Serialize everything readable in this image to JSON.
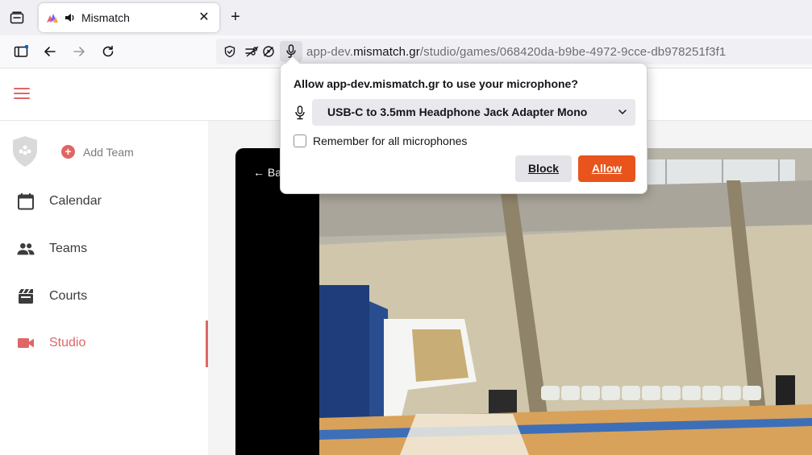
{
  "browser": {
    "tab": {
      "title": "Mismatch",
      "close_glyph": "✕"
    },
    "new_tab_glyph": "+",
    "url": {
      "prefix": "app-dev.",
      "host": "mismatch.gr",
      "path": "/studio/games/068420da-b9be-4972-9cce-db978251f3f1"
    }
  },
  "permission_popup": {
    "title": "Allow app-dev.mismatch.gr to use your microphone?",
    "device_selected": "USB-C to 3.5mm Headphone Jack Adapter Mono",
    "remember_label": "Remember for all microphones",
    "remember_checked": false,
    "block_label": "Block",
    "allow_label": "Allow",
    "allow_color": "#e8541c"
  },
  "app": {
    "accent_color": "#e06666",
    "add_team_label": "Add Team",
    "nav": [
      {
        "label": "Calendar",
        "icon": "calendar-icon",
        "active": false
      },
      {
        "label": "Teams",
        "icon": "people-icon",
        "active": false
      },
      {
        "label": "Courts",
        "icon": "court-icon",
        "active": false
      },
      {
        "label": "Studio",
        "icon": "videocam-icon",
        "active": true
      }
    ],
    "player": {
      "back_label": "← Ba"
    }
  }
}
